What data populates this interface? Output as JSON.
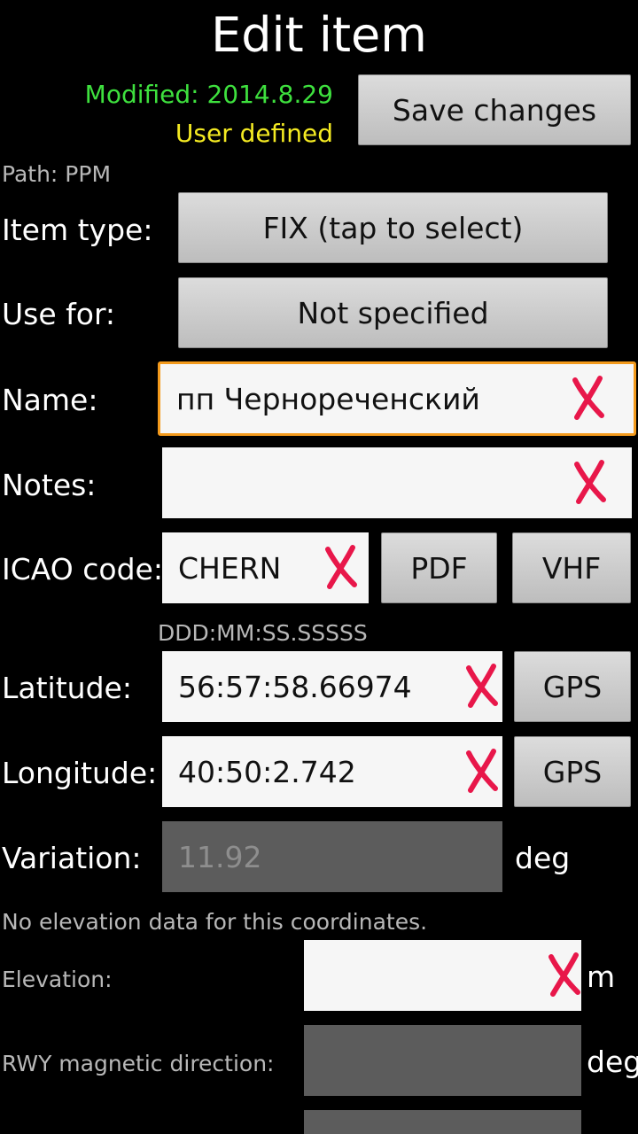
{
  "header": {
    "title": "Edit item",
    "modified": "Modified: 2014.8.29",
    "source": "User defined",
    "save_label": "Save changes"
  },
  "path": "Path: PPM",
  "item_type": {
    "label": "Item type:",
    "value": "FIX (tap to select)"
  },
  "use_for": {
    "label": "Use for:",
    "value": "Not specified"
  },
  "name": {
    "label": "Name:",
    "value": "пп Чернореченский"
  },
  "notes": {
    "label": "Notes:",
    "value": ""
  },
  "icao": {
    "label": "ICAO code:",
    "value": "CHERN",
    "pdf_label": "PDF",
    "vhf_label": "VHF"
  },
  "coord_format": "DDD:MM:SS.SSSSS",
  "latitude": {
    "label": "Latitude:",
    "value": "56:57:58.66974",
    "gps_label": "GPS"
  },
  "longitude": {
    "label": "Longitude:",
    "value": "40:50:2.742",
    "gps_label": "GPS"
  },
  "variation": {
    "label": "Variation:",
    "value": "11.92",
    "unit": "deg"
  },
  "elevation_note": "No elevation data for this coordinates.",
  "elevation": {
    "label": "Elevation:",
    "value": "",
    "unit": "m"
  },
  "rwy": {
    "label": "RWY magnetic direction:",
    "value": "",
    "unit": "deg"
  },
  "colors": {
    "modified": "#3ee03e",
    "source": "#f4ea22",
    "clear_x": "#e8174a",
    "focus_border": "#f39a1c"
  },
  "icons": {
    "clear": "clear-x-icon"
  }
}
